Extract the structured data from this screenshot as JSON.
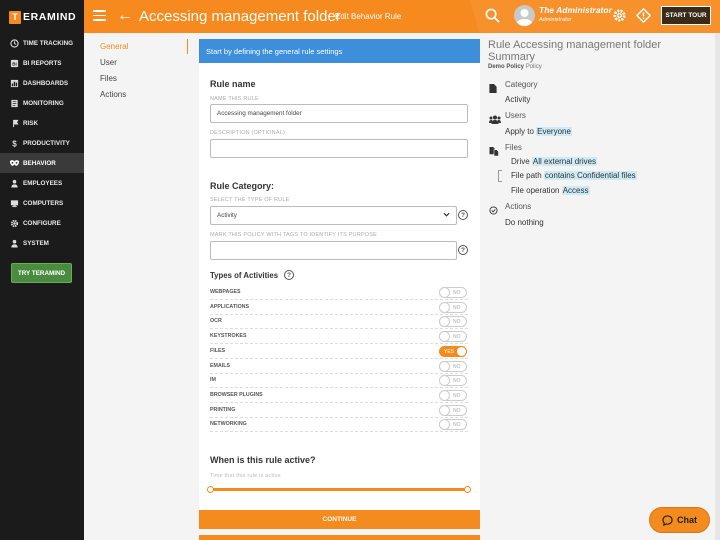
{
  "brand": {
    "mark": "T",
    "name": "ERAMIND"
  },
  "sidebar": {
    "items": [
      {
        "label": "TIME TRACKING",
        "icon": "clock-icon"
      },
      {
        "label": "BI REPORTS",
        "icon": "bi-reports-icon"
      },
      {
        "label": "DASHBOARDS",
        "icon": "dashboard-icon"
      },
      {
        "label": "MONITORING",
        "icon": "monitor-icon"
      },
      {
        "label": "RISK",
        "icon": "risk-icon"
      },
      {
        "label": "PRODUCTIVITY",
        "icon": "dollar-icon"
      },
      {
        "label": "BEHAVIOR",
        "icon": "eye-mask-icon",
        "active": true
      },
      {
        "label": "EMPLOYEES",
        "icon": "employees-icon"
      },
      {
        "label": "COMPUTERS",
        "icon": "computer-icon"
      },
      {
        "label": "CONFIGURE",
        "icon": "gear-icon"
      },
      {
        "label": "SYSTEM",
        "icon": "system-user-icon"
      }
    ],
    "try_button": "TRY TERAMIND"
  },
  "header": {
    "title": "Accessing management folder",
    "subtitle": "Edit Behavior Rule",
    "user_name": "The Administrator",
    "user_role": "Administrator",
    "start_tour": "START TOUR"
  },
  "left_nav": [
    "General",
    "User",
    "Files",
    "Actions"
  ],
  "info_bar": "Start by defining the general rule settings",
  "form": {
    "rule_name_title": "Rule name",
    "name_label": "NAME THIS RULE",
    "name_value": "Accessing management folder",
    "desc_label": "DESCRIPTION (OPTIONAL)",
    "desc_value": "",
    "category_title": "Rule Category:",
    "type_label": "SELECT THE TYPE OF RULE",
    "type_value": "Activity",
    "tags_label": "MARK THIS POLICY WITH TAGS TO IDENTIFY ITS PURPOSE",
    "tags_value": "",
    "help_glyph": "?",
    "activities_title": "Types of Activities",
    "activities": [
      {
        "name": "WEBPAGES",
        "state": "NO",
        "on": false
      },
      {
        "name": "APPLICATIONS",
        "state": "NO",
        "on": false
      },
      {
        "name": "OCR",
        "state": "NO",
        "on": false
      },
      {
        "name": "KEYSTROKES",
        "state": "NO",
        "on": false
      },
      {
        "name": "FILES",
        "state": "YES",
        "on": true
      },
      {
        "name": "EMAILS",
        "state": "NO",
        "on": false
      },
      {
        "name": "IM",
        "state": "NO",
        "on": false
      },
      {
        "name": "BROWSER PLUGINS",
        "state": "NO",
        "on": false
      },
      {
        "name": "PRINTING",
        "state": "NO",
        "on": false
      },
      {
        "name": "NETWORKING",
        "state": "NO",
        "on": false
      }
    ],
    "active_title": "When is this rule active?",
    "active_hint": "Time that this rule is active",
    "continue": "CONTINUE"
  },
  "summary": {
    "title": "Rule Accessing management folder Summary",
    "sub_bold": "Demo Policy",
    "sub_rest": "Policy",
    "category_head": "Category",
    "category_value": "Activity",
    "users_head": "Users",
    "users_prefix": "Apply to",
    "users_value": "Everyone",
    "files_head": "Files",
    "files_lines": [
      {
        "prefix": "Drive",
        "value": "All external drives"
      },
      {
        "prefix": "File path",
        "value": "contains Confidential files"
      },
      {
        "prefix": "File operation",
        "value": "Access"
      }
    ],
    "actions_head": "Actions",
    "actions_value": "Do nothing"
  },
  "chat": "Chat",
  "colors": {
    "accent": "#f38b1e",
    "info": "#3d8fdb",
    "sidebar": "#1b1b1b"
  }
}
